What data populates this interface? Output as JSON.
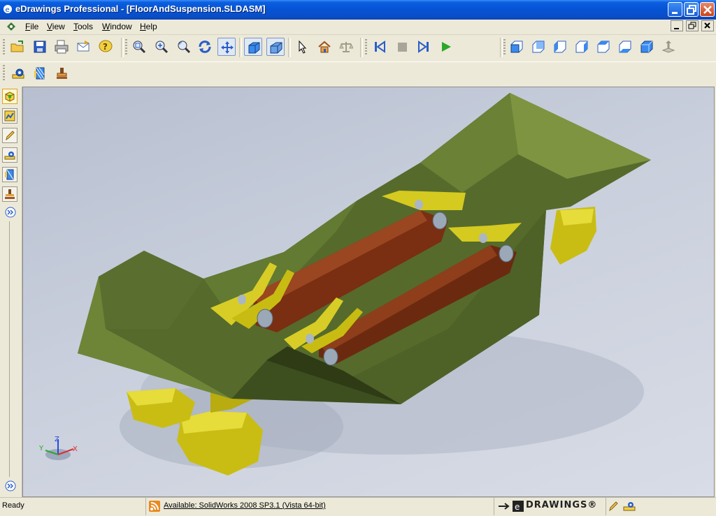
{
  "window": {
    "title": "eDrawings Professional - [FloorAndSuspension.SLDASM]",
    "app_icon": "edrawings-logo-icon"
  },
  "menu": {
    "items": [
      {
        "label": "File",
        "underline": "F"
      },
      {
        "label": "View",
        "underline": "V"
      },
      {
        "label": "Tools",
        "underline": "T"
      },
      {
        "label": "Window",
        "underline": "W"
      },
      {
        "label": "Help",
        "underline": "H"
      }
    ]
  },
  "toolbar_main": {
    "groups": [
      [
        "open-icon",
        "save-icon",
        "print-icon",
        "send-icon",
        "help-icon"
      ],
      [
        "zoom-to-fit-icon",
        "zoom-in-out-icon",
        "zoom-to-area-icon",
        "rotate-icon",
        "pan-icon"
      ],
      [
        "shaded-view-icon",
        "perspective-view-icon"
      ],
      [
        "select-icon",
        "home-icon",
        "measure-icon"
      ],
      [
        "play-first-icon",
        "stop-icon",
        "play-last-icon",
        "play-icon"
      ],
      [
        "front-view-icon",
        "back-view-icon",
        "left-view-icon",
        "right-view-icon",
        "top-view-icon",
        "bottom-view-icon",
        "isometric-view-icon",
        "floor-view-icon"
      ]
    ]
  },
  "toolbar_markup": [
    "measure-tape-icon",
    "section-icon",
    "stamp-icon"
  ],
  "sidebar": [
    "components-icon",
    "configurations-icon",
    "markup-icon",
    "measure-icon",
    "section-icon",
    "stamp-icon",
    "expand-icon"
  ],
  "viewport": {
    "model_name": "FloorAndSuspension.SLDASM",
    "triad": {
      "x": "X",
      "y": "Y",
      "z": "Z"
    },
    "colors": {
      "body": "#556b2f",
      "links": "#7a2e12",
      "brackets": "#c8c020",
      "background": "#c5cbd8"
    }
  },
  "status": {
    "text": "Ready",
    "update_link": "Available: SolidWorks 2008 SP3.1 (Vista 64-bit)",
    "brand": "DRAWINGS®"
  },
  "colors": {
    "titlebar": "#0a5fe0",
    "chrome": "#ece9d8"
  }
}
